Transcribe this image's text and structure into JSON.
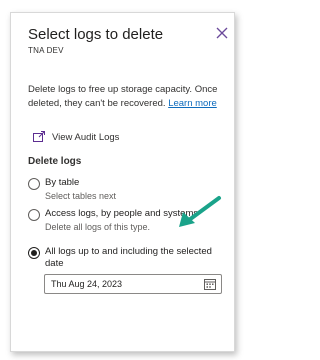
{
  "panel": {
    "title": "Select logs to delete",
    "subtitle": "TNA DEV",
    "close_label": "Close",
    "description": "Delete logs to free up storage capacity. Once deleted, they can't be recovered.",
    "learn_more": "Learn more"
  },
  "audit": {
    "label": "View Audit Logs",
    "icon": "open-in-window-icon"
  },
  "delete_logs": {
    "heading": "Delete logs",
    "options": [
      {
        "label": "By table",
        "hint": "Select tables next",
        "selected": false
      },
      {
        "label": "Access logs, by people and systems",
        "hint": "Delete all logs of this type.",
        "selected": false
      },
      {
        "label": "All logs up to and including the selected date",
        "hint": "",
        "selected": true
      }
    ],
    "date_value": "Thu Aug 24, 2023",
    "date_icon": "calendar-icon"
  },
  "colors": {
    "link": "#0f6cbd",
    "annotation_arrow": "#1aa38a",
    "text": "#201f1e"
  }
}
